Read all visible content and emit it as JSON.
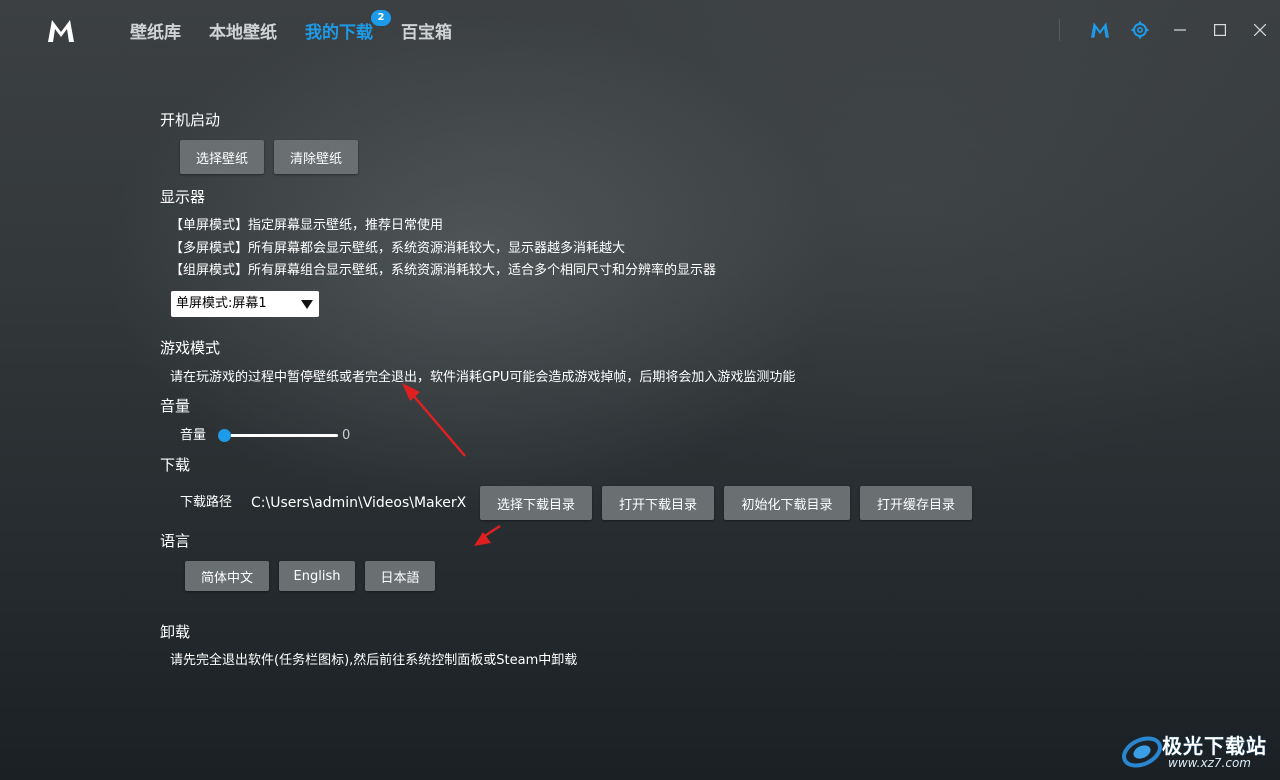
{
  "nav": {
    "items": [
      "壁纸库",
      "本地壁纸",
      "我的下载",
      "百宝箱"
    ],
    "active_index": 2,
    "download_badge": "2"
  },
  "colors": {
    "accent": "#1e9be8",
    "button_bg": "#6a6f72",
    "annotation_arrow": "#e02020"
  },
  "icons": {
    "logo": "m-logo-icon",
    "brand": "m-brand-icon",
    "settings": "gear-icon",
    "minimize": "minimize-icon",
    "maximize": "maximize-icon",
    "close": "close-icon"
  },
  "startup": {
    "title": "开机启动",
    "select_wallpaper": "选择壁纸",
    "clear_wallpaper": "清除壁纸"
  },
  "display": {
    "title": "显示器",
    "desc": [
      "【单屏模式】指定屏幕显示壁纸，推荐日常使用",
      "【多屏模式】所有屏幕都会显示壁纸，系统资源消耗较大，显示器越多消耗越大",
      "【组屏模式】所有屏幕组合显示壁纸，系统资源消耗较大，适合多个相同尺寸和分辨率的显示器"
    ],
    "mode_selected": "单屏模式:屏幕1"
  },
  "game": {
    "title": "游戏模式",
    "desc": "请在玩游戏的过程中暂停壁纸或者完全退出，软件消耗GPU可能会造成游戏掉帧，后期将会加入游戏监测功能"
  },
  "volume": {
    "title": "音量",
    "label": "音量",
    "value": "0"
  },
  "download": {
    "title": "下载",
    "path_label": "下载路径",
    "path_value": "C:\\Users\\admin\\Videos\\MakerX",
    "buttons": [
      "选择下载目录",
      "打开下载目录",
      "初始化下载目录",
      "打开缓存目录"
    ]
  },
  "language": {
    "title": "语言",
    "options": [
      "简体中文",
      "English",
      "日本語"
    ]
  },
  "uninstall": {
    "title": "卸载",
    "desc": "请先完全退出软件(任务栏图标),然后前往系统控制面板或Steam中卸载"
  },
  "watermark": {
    "name": "极光下载站",
    "url": "www.xz7.com"
  }
}
